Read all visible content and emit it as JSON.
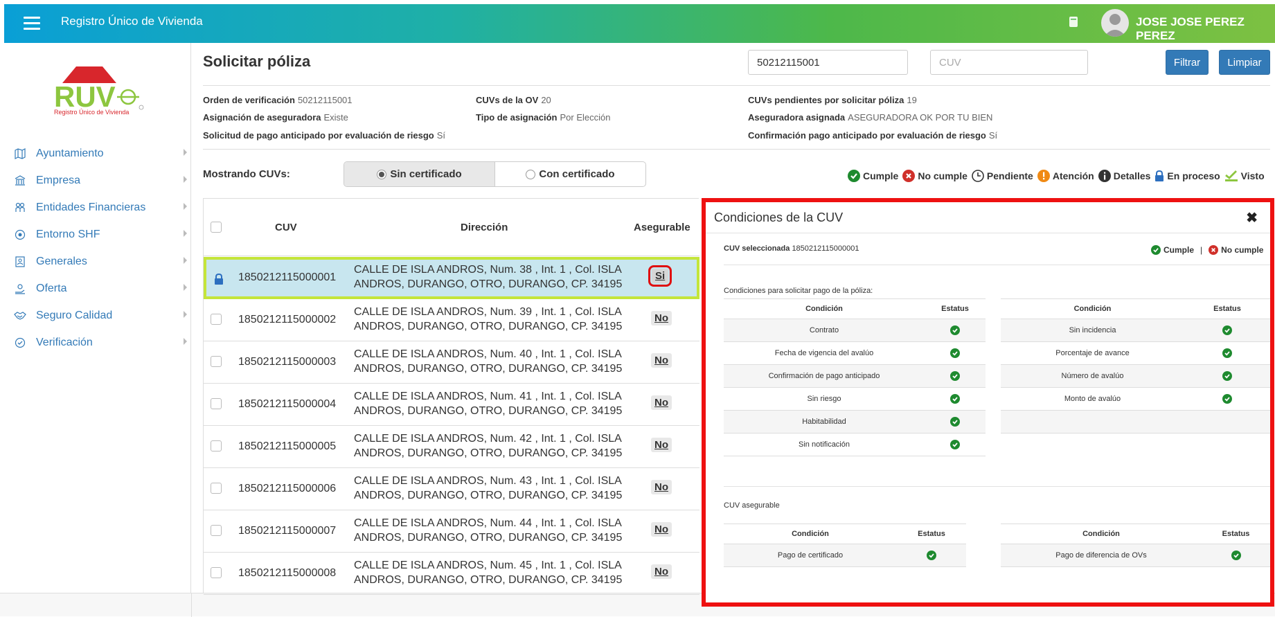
{
  "app": {
    "title": "Registro Único de Vivienda",
    "user": "JOSE JOSE PEREZ PEREZ"
  },
  "logo": {
    "text": "RUV",
    "subtitle": "Registro Único de Vivienda"
  },
  "sidebar": {
    "items": [
      {
        "label": "Ayuntamiento",
        "icon": "map-icon"
      },
      {
        "label": "Empresa",
        "icon": "bank-icon"
      },
      {
        "label": "Entidades Financieras",
        "icon": "users-icon"
      },
      {
        "label": "Entorno SHF",
        "icon": "target-icon"
      },
      {
        "label": "Generales",
        "icon": "document-icon"
      },
      {
        "label": "Oferta",
        "icon": "hand-icon"
      },
      {
        "label": "Seguro Calidad",
        "icon": "handshake-icon"
      },
      {
        "label": "Verificación",
        "icon": "check-circle-icon"
      }
    ]
  },
  "page": {
    "title": "Solicitar póliza",
    "search_value": "50212115001",
    "cuv_placeholder": "CUV",
    "filter_label": "Filtrar",
    "clear_label": "Limpiar"
  },
  "info": {
    "orden_label": "Orden de verificación",
    "orden_value": "50212115001",
    "cuvs_ov_label": "CUVs de la OV",
    "cuvs_ov_value": "20",
    "pend_label": "CUVs pendientes por solicitar póliza",
    "pend_value": "19",
    "asig_label": "Asignación de aseguradora",
    "asig_value": "Existe",
    "tipo_label": "Tipo de asignación",
    "tipo_value": "Por Elección",
    "aseg_label": "Aseguradora asignada",
    "aseg_value": "ASEGURADORA OK POR TU BIEN",
    "sol_label": "Solicitud de pago anticipado por evaluación de riesgo",
    "sol_value": "Sí",
    "conf_label": "Confirmación pago anticipado por evaluación de riesgo",
    "conf_value": "Sí"
  },
  "filter": {
    "mostrando": "Mostrando CUVs:",
    "opt1": "Sin certificado",
    "opt2": "Con certificado",
    "selected": "Sin certificado"
  },
  "legend": {
    "cumple": "Cumple",
    "no_cumple": "No cumple",
    "pendiente": "Pendiente",
    "atencion": "Atención",
    "detalles": "Detalles",
    "en_proceso": "En proceso",
    "visto": "Visto"
  },
  "table": {
    "headers": {
      "cuv": "CUV",
      "direccion": "Dirección",
      "asegurable": "Asegurable"
    },
    "rows": [
      {
        "cuv": "1850212115000001",
        "dir1": "CALLE DE ISLA ANDROS, Num. 38 , Int. 1 , Col. ISLA",
        "dir2": "ANDROS, DURANGO, OTRO, DURANGO, CP. 34195",
        "aseg": "Si"
      },
      {
        "cuv": "1850212115000002",
        "dir1": "CALLE DE ISLA ANDROS, Num. 39 , Int. 1 , Col. ISLA",
        "dir2": "ANDROS, DURANGO, OTRO, DURANGO, CP. 34195",
        "aseg": "No"
      },
      {
        "cuv": "1850212115000003",
        "dir1": "CALLE DE ISLA ANDROS, Num. 40 , Int. 1 , Col. ISLA",
        "dir2": "ANDROS, DURANGO, OTRO, DURANGO, CP. 34195",
        "aseg": "No"
      },
      {
        "cuv": "1850212115000004",
        "dir1": "CALLE DE ISLA ANDROS, Num. 41 , Int. 1 , Col. ISLA",
        "dir2": "ANDROS, DURANGO, OTRO, DURANGO, CP. 34195",
        "aseg": "No"
      },
      {
        "cuv": "1850212115000005",
        "dir1": "CALLE DE ISLA ANDROS, Num. 42 , Int. 1 , Col. ISLA",
        "dir2": "ANDROS, DURANGO, OTRO, DURANGO, CP. 34195",
        "aseg": "No"
      },
      {
        "cuv": "1850212115000006",
        "dir1": "CALLE DE ISLA ANDROS, Num. 43 , Int. 1 , Col. ISLA",
        "dir2": "ANDROS, DURANGO, OTRO, DURANGO, CP. 34195",
        "aseg": "No"
      },
      {
        "cuv": "1850212115000007",
        "dir1": "CALLE DE ISLA ANDROS, Num. 44 , Int. 1 , Col. ISLA",
        "dir2": "ANDROS, DURANGO, OTRO, DURANGO, CP. 34195",
        "aseg": "No"
      },
      {
        "cuv": "1850212115000008",
        "dir1": "CALLE DE ISLA ANDROS, Num. 45 , Int. 1 , Col. ISLA",
        "dir2": "ANDROS, DURANGO, OTRO, DURANGO, CP. 34195",
        "aseg": "No"
      }
    ]
  },
  "panel": {
    "title": "Condiciones de la CUV",
    "sel_label": "CUV seleccionada",
    "sel_value": "1850212115000001",
    "leg_cumple": "Cumple",
    "leg_sep": "|",
    "leg_no": "No cumple",
    "section1": "Condiciones para solicitar pago de la póliza:",
    "section2": "CUV asegurable",
    "col_cond": "Condición",
    "col_status": "Estatus",
    "left": [
      "Contrato",
      "Fecha de vigencia del avalúo",
      "Confirmación de pago anticipado",
      "Sin riesgo",
      "Habitabilidad",
      "Sin notificación"
    ],
    "right": [
      "Sin incidencia",
      "Porcentaje de avance",
      "Número de avalúo",
      "Monto de avalúo"
    ],
    "aseg_left": [
      "Pago de certificado"
    ],
    "aseg_right": [
      "Pago de diferencia de OVs"
    ]
  },
  "colors": {
    "accent": "#337ab7",
    "cumple": "#1e8a2f",
    "no_cumple": "#d0302a",
    "atencion": "#f08a14",
    "highlight": "#ee1111",
    "selected_border": "#c4e53a"
  }
}
